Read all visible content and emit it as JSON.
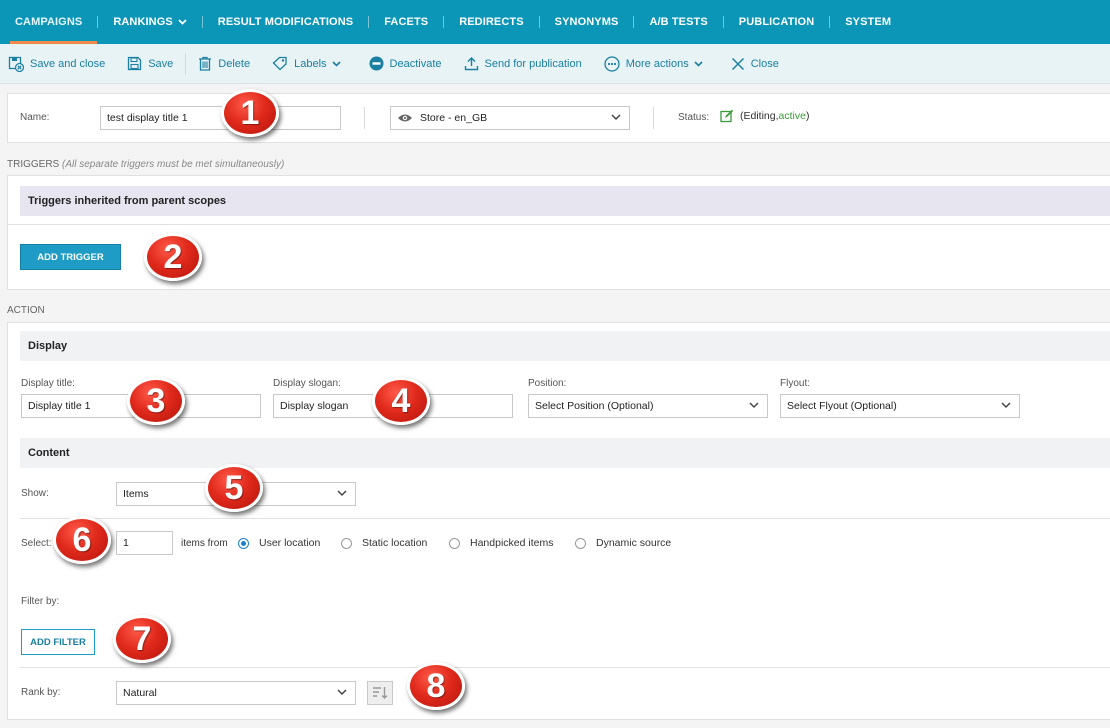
{
  "nav": {
    "items": [
      {
        "label": "CAMPAIGNS",
        "active": true,
        "dropdown": false
      },
      {
        "label": "RANKINGS",
        "active": false,
        "dropdown": true
      },
      {
        "label": "RESULT MODIFICATIONS",
        "active": false,
        "dropdown": false
      },
      {
        "label": "FACETS",
        "active": false,
        "dropdown": false
      },
      {
        "label": "REDIRECTS",
        "active": false,
        "dropdown": false
      },
      {
        "label": "SYNONYMS",
        "active": false,
        "dropdown": false
      },
      {
        "label": "A/B TESTS",
        "active": false,
        "dropdown": false
      },
      {
        "label": "PUBLICATION",
        "active": false,
        "dropdown": false
      },
      {
        "label": "SYSTEM",
        "active": false,
        "dropdown": false
      }
    ]
  },
  "toolbar": {
    "save_close": "Save and close",
    "save": "Save",
    "delete": "Delete",
    "labels": "Labels",
    "deactivate": "Deactivate",
    "send": "Send for publication",
    "more": "More actions",
    "close": "Close"
  },
  "header": {
    "name_label": "Name:",
    "name_value": "test display title 1",
    "store_value": "Store - en_GB",
    "status_label": "Status:",
    "status_open": "(Editing, ",
    "status_active": "active",
    "status_close": ")"
  },
  "triggers": {
    "caption": "TRIGGERS",
    "caption_note": "(All separate triggers must be met simultaneously)",
    "inherited": "Triggers inherited from parent scopes",
    "add_button": "ADD TRIGGER"
  },
  "action": {
    "caption": "ACTION",
    "display_head": "Display",
    "display_title_label": "Display title:",
    "display_title_value": "Display title 1",
    "display_slogan_label": "Display slogan:",
    "display_slogan_value": "Display slogan",
    "position_label": "Position:",
    "position_value": "Select Position (Optional)",
    "flyout_label": "Flyout:",
    "flyout_value": "Select Flyout (Optional)",
    "content_head": "Content",
    "show_label": "Show:",
    "show_value": "Items",
    "select_label": "Select:",
    "select_count": "1",
    "items_from": "items from",
    "sources": [
      {
        "label": "User location",
        "selected": true
      },
      {
        "label": "Static location",
        "selected": false
      },
      {
        "label": "Handpicked items",
        "selected": false
      },
      {
        "label": "Dynamic source",
        "selected": false
      }
    ],
    "filter_label": "Filter by:",
    "add_filter": "ADD FILTER",
    "rank_label": "Rank by:",
    "rank_value": "Natural"
  },
  "markers": [
    "1",
    "2",
    "3",
    "4",
    "5",
    "6",
    "7",
    "8"
  ],
  "colors": {
    "nav_bg": "#0b96b8",
    "nav_active_underline": "#f08a4b",
    "accent": "#1e9cc5",
    "status_active": "#3a9a3a",
    "marker_red": "#e02a1c"
  }
}
